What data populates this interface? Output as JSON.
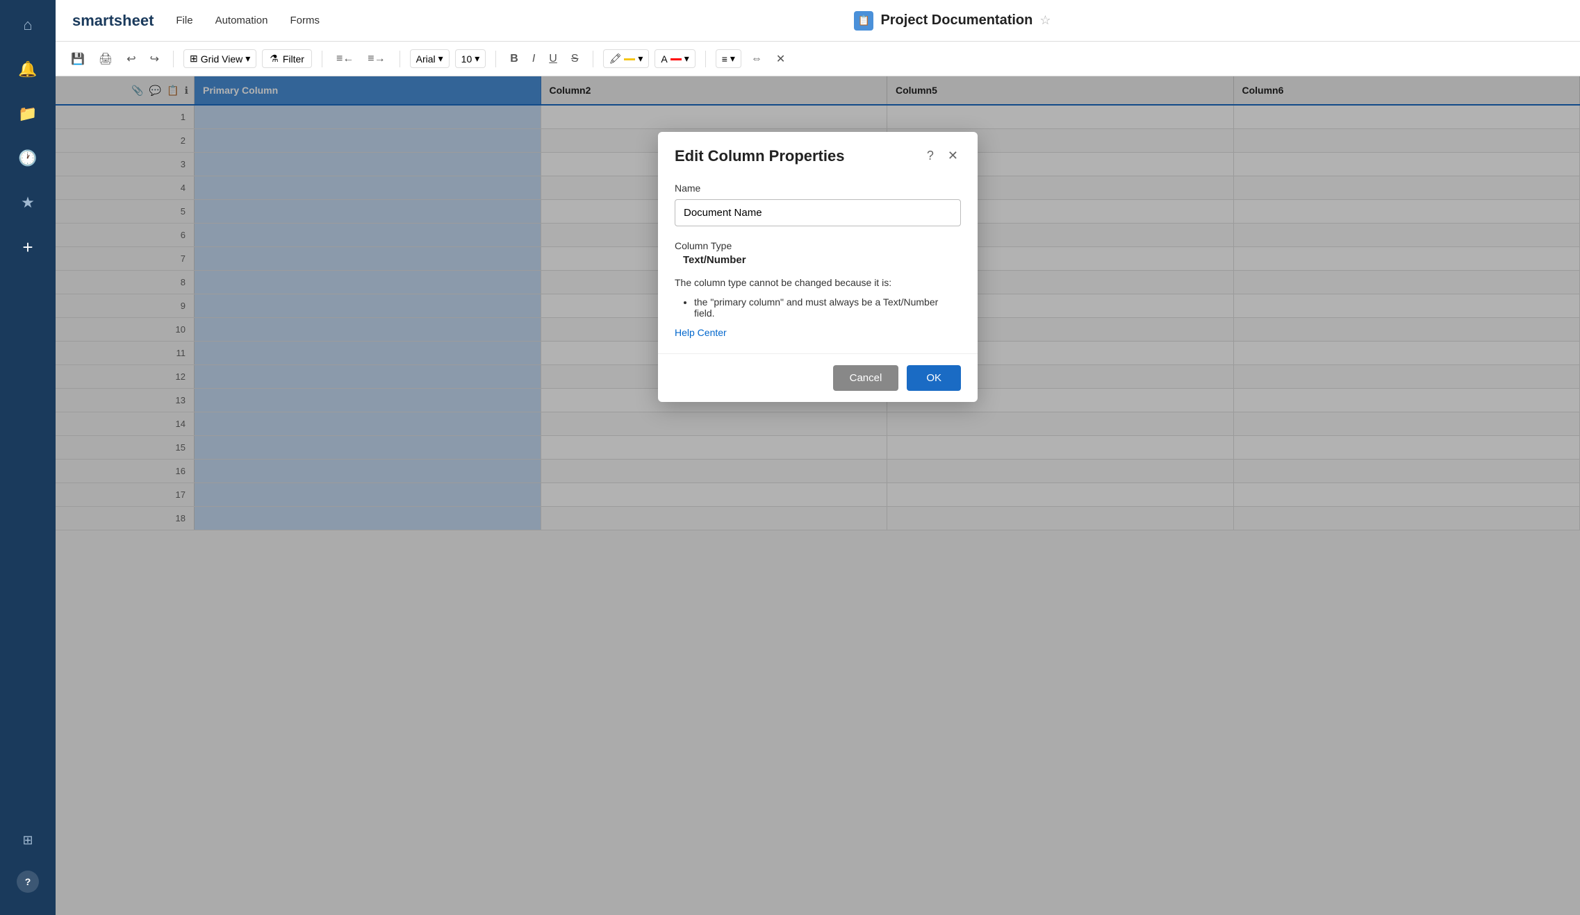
{
  "app": {
    "name": "smartsheet"
  },
  "sidebar": {
    "icons": [
      {
        "name": "home-icon",
        "glyph": "⌂",
        "label": "Home"
      },
      {
        "name": "bell-icon",
        "glyph": "🔔",
        "label": "Notifications"
      },
      {
        "name": "folder-icon",
        "glyph": "📁",
        "label": "Browse"
      },
      {
        "name": "clock-icon",
        "glyph": "🕐",
        "label": "Recents"
      },
      {
        "name": "star-icon",
        "glyph": "★",
        "label": "Favorites"
      },
      {
        "name": "plus-icon",
        "glyph": "+",
        "label": "New"
      }
    ],
    "bottom_icons": [
      {
        "name": "grid-icon",
        "glyph": "⊞",
        "label": "Apps"
      },
      {
        "name": "help-icon",
        "glyph": "?",
        "label": "Help"
      }
    ]
  },
  "topbar": {
    "nav_items": [
      "File",
      "Automation",
      "Forms"
    ],
    "sheet_title": "Project Documentation"
  },
  "toolbar": {
    "grid_view_label": "Grid View",
    "filter_label": "Filter",
    "font_label": "Arial",
    "font_size": "10",
    "bold_label": "B",
    "italic_label": "I",
    "underline_label": "U",
    "strikethrough_label": "S"
  },
  "grid": {
    "columns": [
      {
        "label": "Primary Column",
        "primary": true
      },
      {
        "label": "Column2",
        "primary": false
      },
      {
        "label": "Column5",
        "primary": false
      },
      {
        "label": "Column6",
        "primary": false
      }
    ],
    "rows": [
      1,
      2,
      3,
      4,
      5,
      6,
      7,
      8,
      9,
      10,
      11,
      12,
      13,
      14,
      15,
      16,
      17,
      18
    ]
  },
  "modal": {
    "title": "Edit Column Properties",
    "name_label": "Name",
    "name_value": "Document Name",
    "column_type_label": "Column Type",
    "column_type_value": "Text/Number",
    "restriction_text": "The column type cannot be changed because it is:",
    "restriction_item": "the \"primary column\" and must always be a Text/Number field.",
    "help_link_label": "Help Center",
    "cancel_label": "Cancel",
    "ok_label": "OK"
  }
}
